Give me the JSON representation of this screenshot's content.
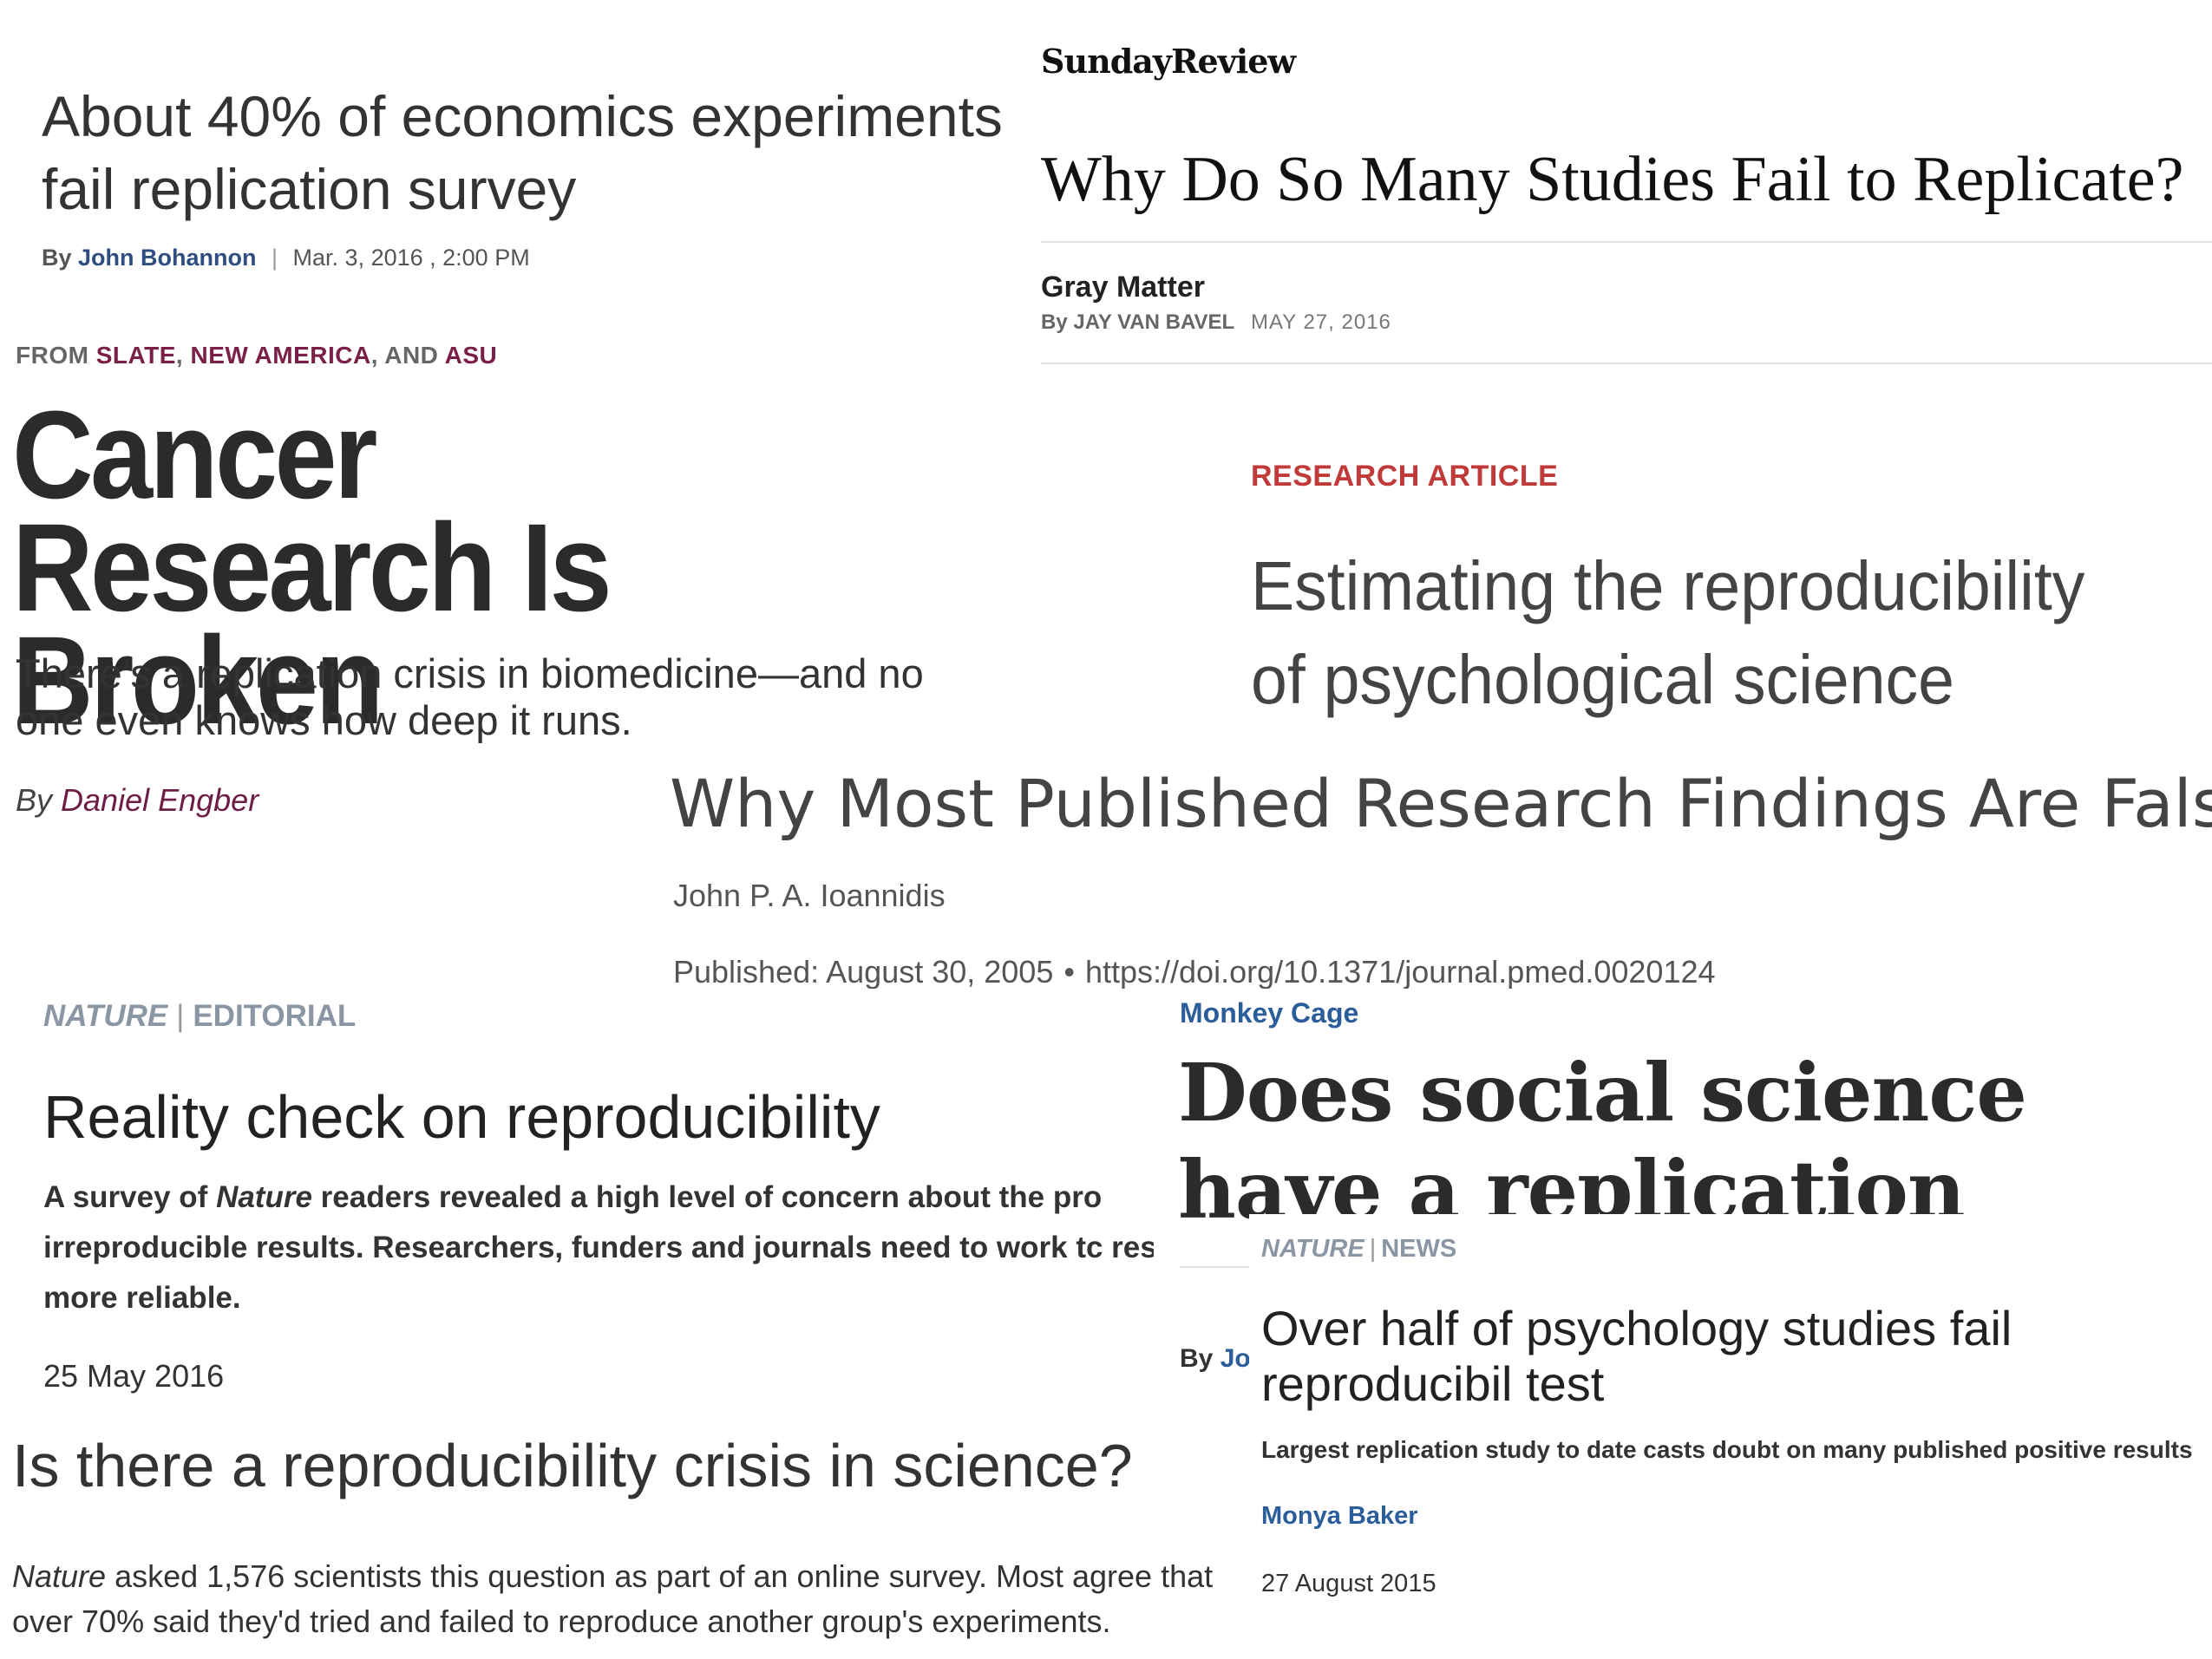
{
  "science_econ": {
    "headline": "About 40% of economics experiments fail replication survey",
    "by_label": "By",
    "author": "John Bohannon",
    "separator": "|",
    "dateline": "Mar. 3, 2016 , 2:00 PM"
  },
  "nyt": {
    "section": "SundayReview",
    "headline": "Why Do So Many Studies Fail to Replicate?",
    "column": "Gray Matter",
    "byline": "By JAY VAN BAVEL",
    "date": "MAY 27, 2016"
  },
  "slate": {
    "from_prefix": "FROM",
    "org_1": "SLATE",
    "comma_1": ",",
    "org_2": "NEW AMERICA",
    "and": ", AND",
    "org_3": "ASU",
    "headline": "Cancer Research Is Broken",
    "dek": "There’s a replication crisis in biomedicine—and no one even knows how deep it runs.",
    "by_label": "By",
    "author": "Daniel Engber",
    "org_color": "#7a1f45"
  },
  "science_article": {
    "label": "RESEARCH ARTICLE",
    "headline": "Estimating the reproducibility of psychological science",
    "label_color": "#c03a3a"
  },
  "plos": {
    "headline": "Why Most Published Research Findings Are False",
    "author": "John P. A. Ioannidis",
    "published": "Published: August 30, 2005",
    "bullet": "•",
    "doi": "https://doi.org/10.1371/journal.pmed.0020124"
  },
  "nature_editorial": {
    "brand": "NATURE",
    "separator": "|",
    "kicker": "EDITORIAL",
    "headline": "Reality check on reproducibility",
    "dek_part_1": "A survey of",
    "dek_italic": "Nature",
    "dek_part_2": "readers revealed a high level of concern about the pro irreproducible results. Researchers, funders and journals need to work tc research more reliable.",
    "date": "25 May 2016"
  },
  "wapo": {
    "section": "Monkey Cage",
    "headline": "Does social science have a replication crisis?",
    "by_label": "By",
    "author_fragment": "Jos",
    "section_color": "#2a5d99"
  },
  "nature_news": {
    "brand": "NATURE",
    "separator": "|",
    "kicker": "NEWS",
    "headline": "Over half of psychology studies fail reproducibil test",
    "dek": "Largest replication study to date casts doubt on many published positive results",
    "author": "Monya Baker",
    "date": "27 August 2015"
  },
  "nature_survey": {
    "headline": "Is there a reproducibility crisis in science?",
    "body_italic": "Nature",
    "body": "asked 1,576 scientists this question as part of an online survey. Most agree that over 70% said they'd tried and failed to reproduce another group's experiments."
  }
}
